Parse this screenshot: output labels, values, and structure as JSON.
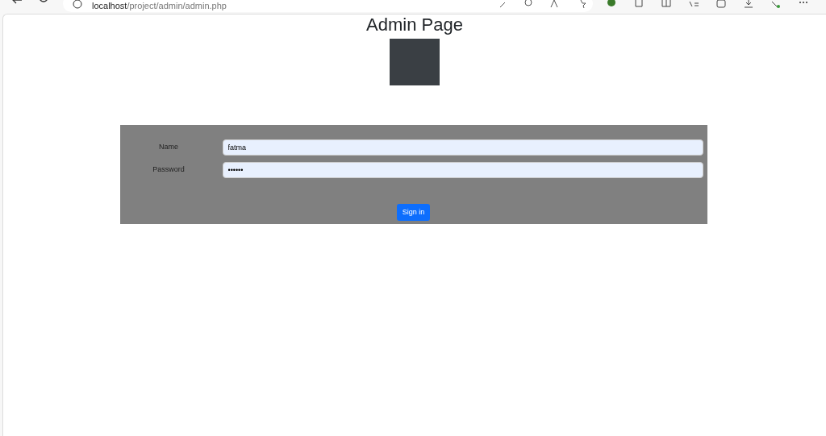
{
  "browser": {
    "url_host": "localhost",
    "url_path": "/project/admin/admin.php"
  },
  "page": {
    "title": "Admin Page"
  },
  "form": {
    "fields": [
      {
        "label": "Name",
        "value": "fatma"
      },
      {
        "label": "Password",
        "value": "••••••"
      }
    ],
    "submit": "Sign in"
  }
}
